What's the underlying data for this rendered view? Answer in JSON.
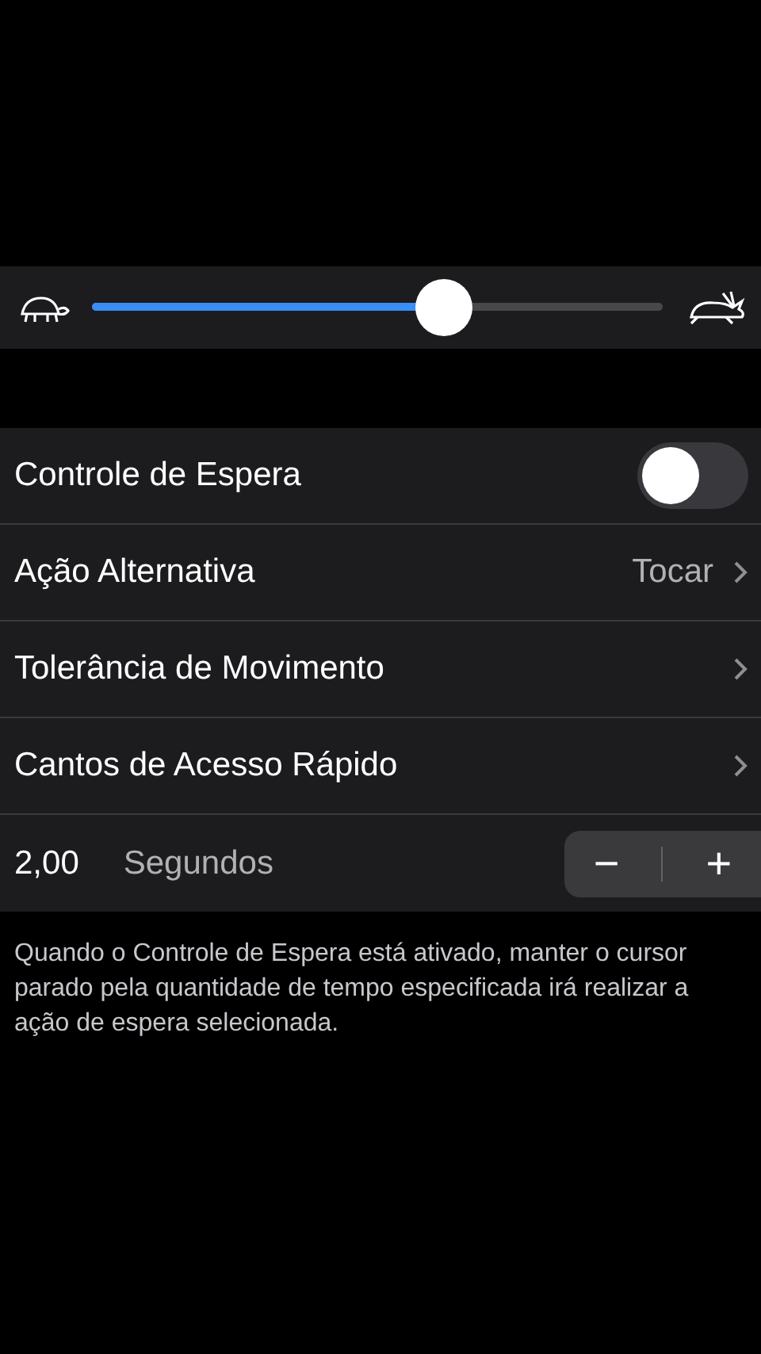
{
  "speed_slider": {
    "level": 0.63
  },
  "rows": [
    {
      "kind": "toggle",
      "label": "Controle de Espera",
      "on": false
    },
    {
      "kind": "link",
      "label": "Ação Alternativa",
      "value": "Tocar"
    },
    {
      "kind": "link",
      "label": "Tolerância de Movimento"
    },
    {
      "kind": "link",
      "label": "Cantos de Acesso Rápido"
    },
    {
      "kind": "stepper",
      "value": "2,00",
      "unit": "Segundos",
      "minus": "−",
      "plus": "+"
    }
  ],
  "footer": "Quando o Controle de Espera está ativado, manter o cursor parado pela quantidade de tempo especificada irá realizar a ação de espera selecionada."
}
